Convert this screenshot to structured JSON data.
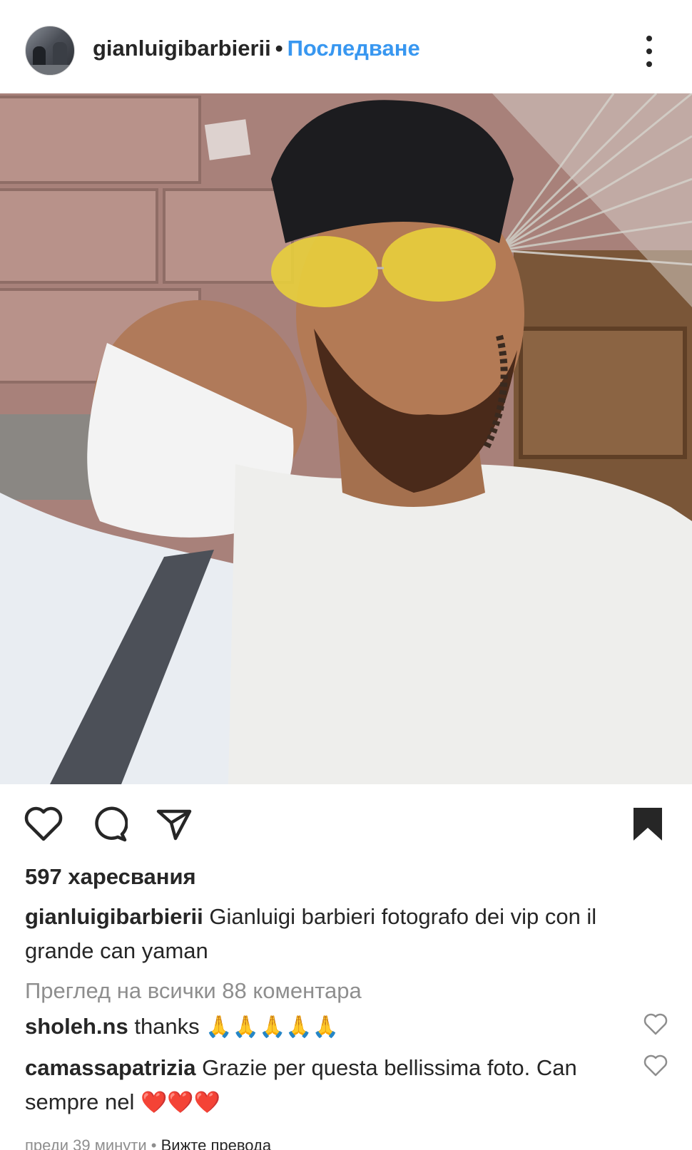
{
  "header": {
    "username": "gianluigibarbierii",
    "separator": "•",
    "follow_label": "Последване"
  },
  "post": {
    "image_alt": "Selfie photo of two men",
    "likes_text": "597 харесвания",
    "caption": {
      "username": "gianluigibarbierii",
      "text": "Gianluigi barbieri fotografo dei vip con il grande can yaman"
    },
    "view_all_comments": "Преглед на всички 88 коментара",
    "comments": [
      {
        "username": "sholeh.ns",
        "text": "thanks",
        "emoji": "🙏🙏🙏🙏🙏"
      },
      {
        "username": "camassapatrizia",
        "text": "Grazie per questa bellissima foto. Can sempre nel",
        "emoji": "❤️❤️❤️"
      }
    ],
    "timestamp": "преди 39 минути",
    "meta_separator": "•",
    "translate_label": "Вижте превода"
  },
  "icons": {
    "like": "heart-outline-icon",
    "comment": "speech-bubble-icon",
    "share": "paper-plane-icon",
    "save": "bookmark-filled-icon",
    "more": "three-dots-vertical-icon"
  }
}
